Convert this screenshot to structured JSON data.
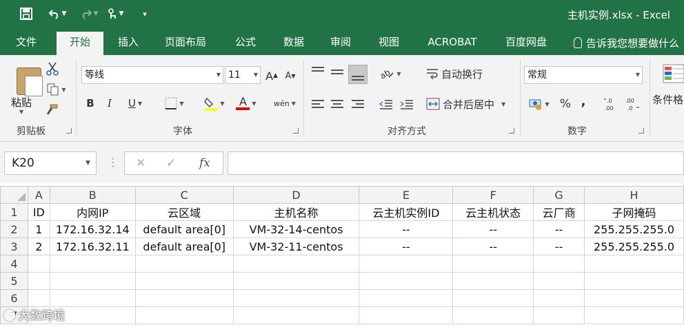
{
  "window": {
    "title": "主机实例.xlsx - Excel"
  },
  "tabs": [
    "文件",
    "开始",
    "插入",
    "页面布局",
    "公式",
    "数据",
    "审阅",
    "视图",
    "ACROBAT",
    "百度网盘"
  ],
  "tell_me": "告诉我您想要做什么",
  "ribbon": {
    "clipboard": {
      "paste": "粘贴",
      "group": "剪贴板"
    },
    "font": {
      "name": "等线",
      "size": "11",
      "bold": "B",
      "italic": "I",
      "underline": "U",
      "grow": "A",
      "shrink": "A",
      "color_letter": "A",
      "phonetic": "wén",
      "group": "字体"
    },
    "alignment": {
      "wrap": "自动换行",
      "merge": "合并后居中",
      "group": "对齐方式"
    },
    "number": {
      "format": "常规",
      "percent": "%",
      "comma": ",",
      "group": "数字"
    },
    "styles": {
      "conditional": "条件格"
    }
  },
  "formula_bar": {
    "name_box": "K20",
    "cancel": "✕",
    "enter": "✓",
    "fx": "fx",
    "content": ""
  },
  "sheet": {
    "columns": [
      "A",
      "B",
      "C",
      "D",
      "E",
      "F",
      "G",
      "H"
    ],
    "rows": [
      [
        "ID",
        "内网IP",
        "云区域",
        "主机名称",
        "云主机实例ID",
        "云主机状态",
        "云厂商",
        "子网掩码"
      ],
      [
        "1",
        "172.16.32.14",
        "default area[0]",
        "VM-32-14-centos",
        "--",
        "--",
        "--",
        "255.255.255.0"
      ],
      [
        "2",
        "172.16.32.11",
        "default area[0]",
        "VM-32-11-centos",
        "--",
        "--",
        "--",
        "255.255.255.0"
      ],
      [
        "",
        "",
        "",
        "",
        "",
        "",
        "",
        ""
      ],
      [
        "",
        "",
        "",
        "",
        "",
        "",
        "",
        ""
      ],
      [
        "",
        "",
        "",
        "",
        "",
        "",
        "",
        ""
      ],
      [
        "",
        "",
        "",
        "",
        "",
        "",
        "",
        ""
      ]
    ],
    "row_numbers": [
      "1",
      "2",
      "3",
      "4",
      "5",
      "6",
      "7"
    ]
  },
  "watermark": "大数跨境",
  "colors": {
    "accent": "#217346",
    "ribbon_bg": "#f3f3f3"
  }
}
